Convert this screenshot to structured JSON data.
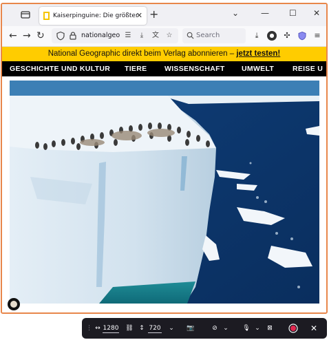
{
  "browser": {
    "tab_title": "Kaiserpinguine: Die größten Dra",
    "url": "nationalgeog",
    "search_placeholder": "Search"
  },
  "promo": {
    "text": "National Geographic direkt beim Verlag abonnieren – ",
    "link": "jetzt testen!"
  },
  "nav": {
    "items": [
      "GESCHICHTE UND KULTUR",
      "TIERE",
      "WISSENSCHAFT",
      "UMWELT",
      "REISE U"
    ]
  },
  "devtools": {
    "width": "1280",
    "height": "720"
  },
  "colors": {
    "promo_bg": "#ffcc00",
    "nav_bg": "#000000",
    "window_border": "#e8864a"
  }
}
